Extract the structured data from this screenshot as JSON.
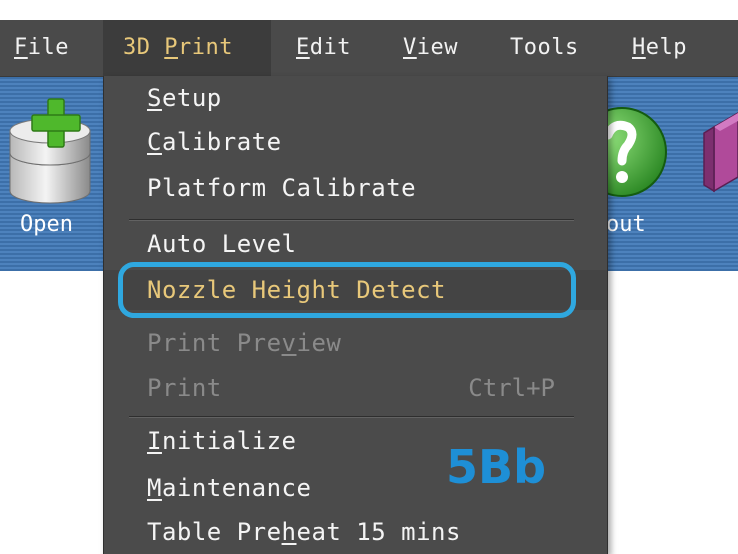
{
  "menubar": {
    "items": [
      {
        "pre": "",
        "mn": "F",
        "post": "ile"
      },
      {
        "pre": "3D ",
        "mn": "P",
        "post": "rint"
      },
      {
        "pre": "",
        "mn": "E",
        "post": "dit"
      },
      {
        "pre": "",
        "mn": "V",
        "post": "iew"
      },
      {
        "pre": "Tools",
        "mn": "",
        "post": ""
      },
      {
        "pre": "",
        "mn": "H",
        "post": "elp"
      }
    ],
    "active_index": 1
  },
  "toolbar": {
    "open_label": "Open",
    "about_label": "out",
    "icons": [
      "add-open-icon",
      "help-icon",
      "cube-icon"
    ]
  },
  "dropdown": {
    "items": [
      {
        "pre": "",
        "mn": "S",
        "post": "etup",
        "shortcut": "",
        "state": "normal"
      },
      {
        "pre": "",
        "mn": "C",
        "post": "alibrate",
        "shortcut": "",
        "state": "normal"
      },
      {
        "pre": "Platform Calibrate",
        "mn": "",
        "post": "",
        "shortcut": "",
        "state": "normal"
      },
      {
        "pre": "Auto Level",
        "mn": "",
        "post": "",
        "shortcut": "",
        "state": "normal"
      },
      {
        "pre": "Nozzle Height Detect",
        "mn": "",
        "post": "",
        "shortcut": "",
        "state": "highlighted"
      },
      {
        "pre": "Print Pre",
        "mn": "v",
        "post": "iew",
        "shortcut": "",
        "state": "disabled"
      },
      {
        "pre": "Print",
        "mn": "",
        "post": "",
        "shortcut": "Ctrl+P",
        "state": "disabled"
      },
      {
        "pre": "",
        "mn": "I",
        "post": "nitialize",
        "shortcut": "",
        "state": "normal"
      },
      {
        "pre": "",
        "mn": "M",
        "post": "aintenance",
        "shortcut": "",
        "state": "normal"
      },
      {
        "pre": "Table Pre",
        "mn": "h",
        "post": "eat 15 mins",
        "shortcut": "",
        "state": "normal"
      }
    ]
  },
  "watermark": "5Bb",
  "colors": {
    "menu_bg": "#4b4b4b",
    "highlight_text": "#e8c87a",
    "disabled_text": "#8a8a8a",
    "callout": "#2fa8e0",
    "toolbar_bg": "#4d82bd"
  }
}
